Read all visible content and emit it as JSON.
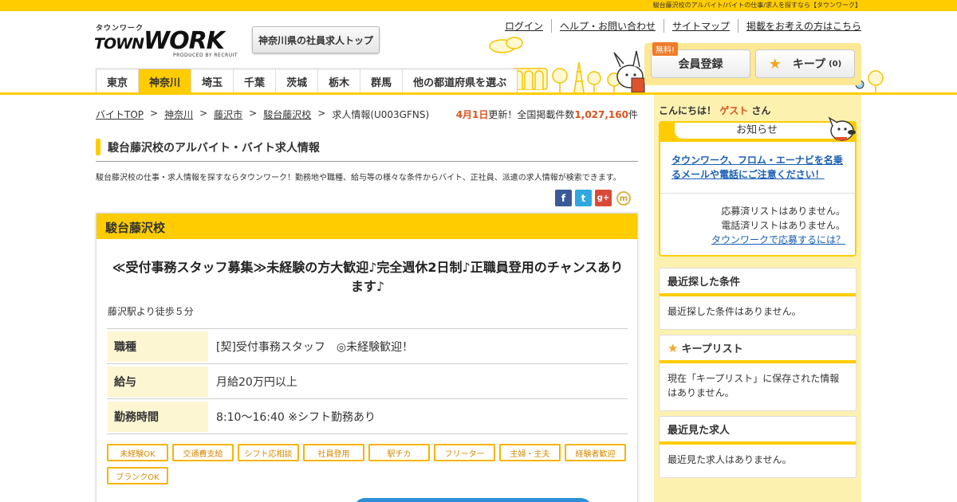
{
  "topbar": {
    "text": "駿台藤沢校のアルバイト/バイトの仕事/求人を探すなら【タウンワーク】"
  },
  "logo": {
    "kana": "タウンワーク",
    "main_a": "TOWN",
    "main_b": "WORK",
    "sub": "PRODUCED BY RECRUIT"
  },
  "header": {
    "pref_top_button": "神奈川県の社員求人トップ",
    "util_links": [
      "ログイン",
      "ヘルプ・お問い合わせ",
      "サイトマップ",
      "掲載をお考えの方はこちら"
    ],
    "register_label": "会員登録",
    "free_badge": "無料!",
    "keep_label": "キープ",
    "keep_count": "(0)"
  },
  "pref_tabs": [
    {
      "label": "東京",
      "active": false
    },
    {
      "label": "神奈川",
      "active": true
    },
    {
      "label": "埼玉",
      "active": false
    },
    {
      "label": "千葉",
      "active": false
    },
    {
      "label": "茨城",
      "active": false
    },
    {
      "label": "栃木",
      "active": false
    },
    {
      "label": "群馬",
      "active": false
    },
    {
      "label": "他の都道府県を選ぶ",
      "active": false
    }
  ],
  "breadcrumb": {
    "items": [
      "バイトTOP",
      "神奈川",
      "藤沢市",
      "駿台藤沢校"
    ],
    "current": "求人情報(U003GFNS)"
  },
  "update": {
    "date": "4月1日",
    "text1": "更新！全国掲載件数",
    "count": "1,027,160",
    "unit": "件"
  },
  "page": {
    "heading": "駿台藤沢校のアルバイト・バイト求人情報",
    "description": "駿台藤沢校の仕事・求人情報を探すならタウンワーク！勤務地や職種、給与等の様々な条件からバイト、正社員、派遣の求人情報が検索できます。"
  },
  "share": {
    "facebook": "f",
    "twitter": "t",
    "google": "g+",
    "mixi": "m"
  },
  "job": {
    "company": "駿台藤沢校",
    "title": "≪受付事務スタッフ募集≫未経験の方大歓迎♪完全週休2日制♪正職員登用のチャンスあります♪",
    "access": "藤沢駅より徒歩５分",
    "rows": [
      {
        "label": "職種",
        "value": "[契]受付事務スタッフ　◎未経験歓迎！"
      },
      {
        "label": "給与",
        "value": "月給20万円以上"
      },
      {
        "label": "勤務時間",
        "value": "8:10～16:40 ※シフト勤務あり"
      }
    ],
    "tags": [
      "未経験OK",
      "交通費支給",
      "シフト応相談",
      "社員登用",
      "駅チカ",
      "フリーター",
      "主婦・主夫",
      "経験者歓迎",
      "ブランクOK"
    ]
  },
  "sidebar": {
    "greeting_a": "こんにちは！",
    "greeting_guest": "ゲスト",
    "greeting_b": "さん",
    "notice_title": "お知らせ",
    "notice_link": "タウンワーク、フロム・エーナビを名乗るメールや電話にご注意ください！",
    "status_applied": "応募済リストはありません。",
    "status_called": "電話済リストはありません。",
    "status_link": "タウンワークで応募するには？",
    "recent_search_title": "最近探した条件",
    "recent_search_body": "最近探した条件はありません。",
    "keep_list_title": "キープリスト",
    "keep_list_body": "現在「キープリスト」に保存された情報はありません。",
    "recent_view_title": "最近見た求人",
    "recent_view_body": "最近見た求人はありません。"
  },
  "colors": {
    "brand_yellow": "#ffcc00",
    "accent_orange": "#d9541e",
    "link_blue": "#1a5fb4"
  }
}
